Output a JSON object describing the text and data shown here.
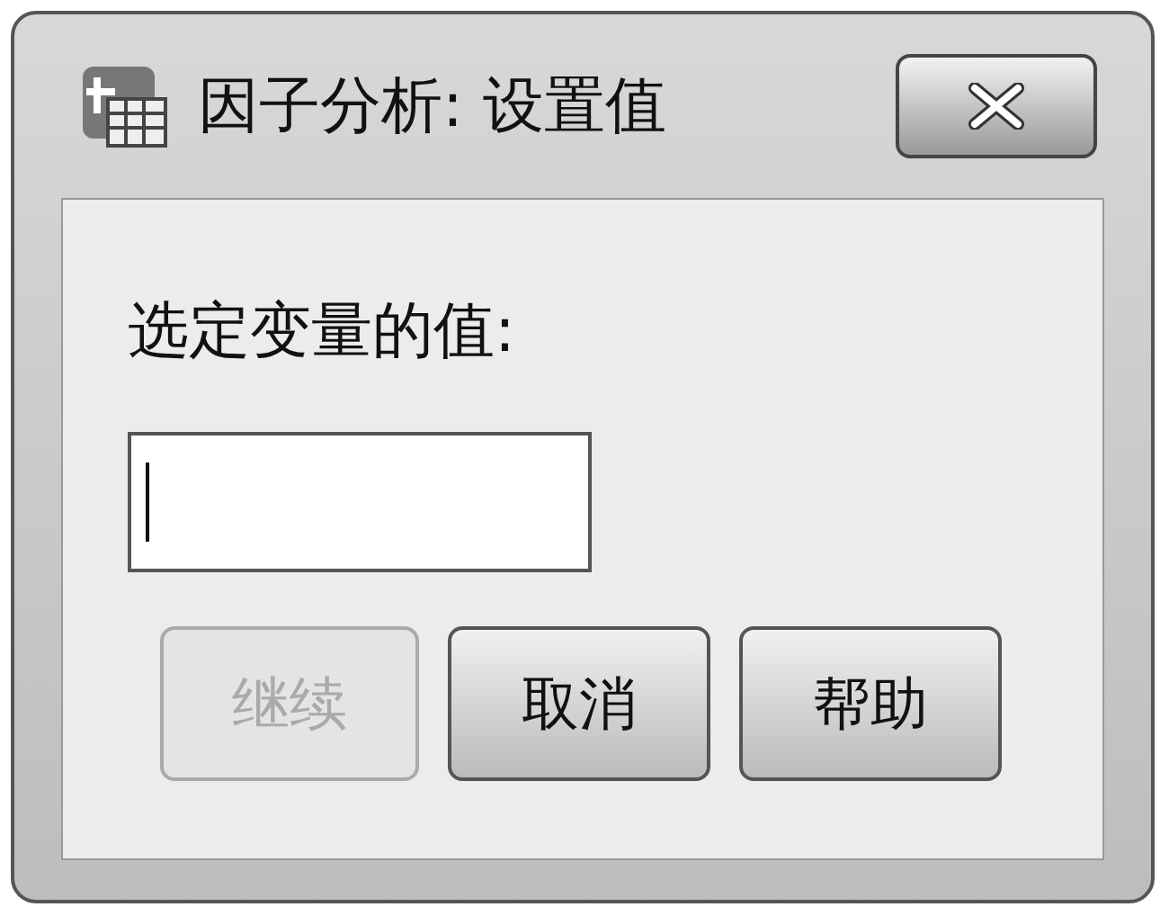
{
  "window": {
    "title": "因子分析: 设置值"
  },
  "label": "选定变量的值:",
  "buttons": [
    {
      "label": "继续",
      "disabled": true
    },
    {
      "label": "取消",
      "disabled": false
    },
    {
      "label": "帮助",
      "disabled": false
    }
  ]
}
